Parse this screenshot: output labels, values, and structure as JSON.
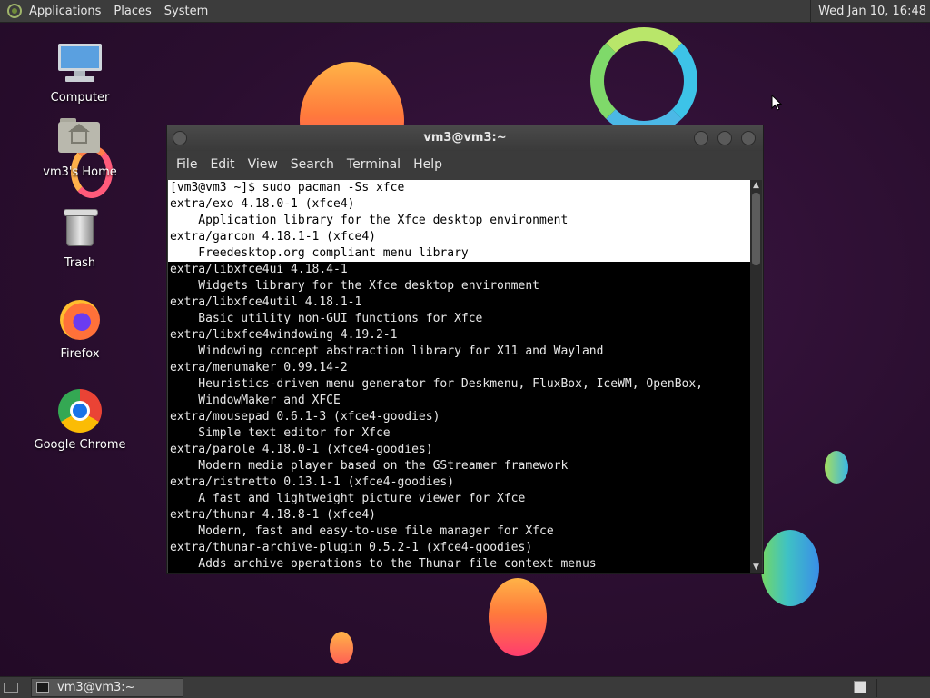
{
  "top_panel": {
    "menus": [
      "Applications",
      "Places",
      "System"
    ],
    "clock": "Wed Jan 10, 16:48"
  },
  "desktop_icons": [
    {
      "label": "Computer",
      "icon": "computer-icon"
    },
    {
      "label": "vm3's Home",
      "icon": "home-folder-icon"
    },
    {
      "label": "Trash",
      "icon": "trash-icon"
    },
    {
      "label": "Firefox",
      "icon": "firefox-icon"
    },
    {
      "label": "Google Chrome",
      "icon": "chrome-icon"
    }
  ],
  "window": {
    "title": "vm3@vm3:~",
    "menus": [
      "File",
      "Edit",
      "View",
      "Search",
      "Terminal",
      "Help"
    ]
  },
  "terminal": {
    "lines": [
      {
        "text": "[vm3@vm3 ~]$ sudo pacman -Ss xfce",
        "selected": true
      },
      {
        "text": "extra/exo 4.18.0-1 (xfce4)",
        "selected": true
      },
      {
        "text": "    Application library for the Xfce desktop environment",
        "selected": true
      },
      {
        "text": "extra/garcon 4.18.1-1 (xfce4)",
        "selected": true
      },
      {
        "text": "    Freedesktop.org compliant menu library",
        "selected": true
      },
      {
        "text": "extra/libxfce4ui 4.18.4-1",
        "selected": false
      },
      {
        "text": "    Widgets library for the Xfce desktop environment",
        "selected": false
      },
      {
        "text": "extra/libxfce4util 4.18.1-1",
        "selected": false
      },
      {
        "text": "    Basic utility non-GUI functions for Xfce",
        "selected": false
      },
      {
        "text": "extra/libxfce4windowing 4.19.2-1",
        "selected": false
      },
      {
        "text": "    Windowing concept abstraction library for X11 and Wayland",
        "selected": false
      },
      {
        "text": "extra/menumaker 0.99.14-2",
        "selected": false
      },
      {
        "text": "    Heuristics-driven menu generator for Deskmenu, FluxBox, IceWM, OpenBox,",
        "selected": false
      },
      {
        "text": "    WindowMaker and XFCE",
        "selected": false
      },
      {
        "text": "extra/mousepad 0.6.1-3 (xfce4-goodies)",
        "selected": false
      },
      {
        "text": "    Simple text editor for Xfce",
        "selected": false
      },
      {
        "text": "extra/parole 4.18.0-1 (xfce4-goodies)",
        "selected": false
      },
      {
        "text": "    Modern media player based on the GStreamer framework",
        "selected": false
      },
      {
        "text": "extra/ristretto 0.13.1-1 (xfce4-goodies)",
        "selected": false
      },
      {
        "text": "    A fast and lightweight picture viewer for Xfce",
        "selected": false
      },
      {
        "text": "extra/thunar 4.18.8-1 (xfce4)",
        "selected": false
      },
      {
        "text": "    Modern, fast and easy-to-use file manager for Xfce",
        "selected": false
      },
      {
        "text": "extra/thunar-archive-plugin 0.5.2-1 (xfce4-goodies)",
        "selected": false
      },
      {
        "text": "    Adds archive operations to the Thunar file context menus",
        "selected": false
      }
    ]
  },
  "taskbar": {
    "task_label": "vm3@vm3:~"
  }
}
